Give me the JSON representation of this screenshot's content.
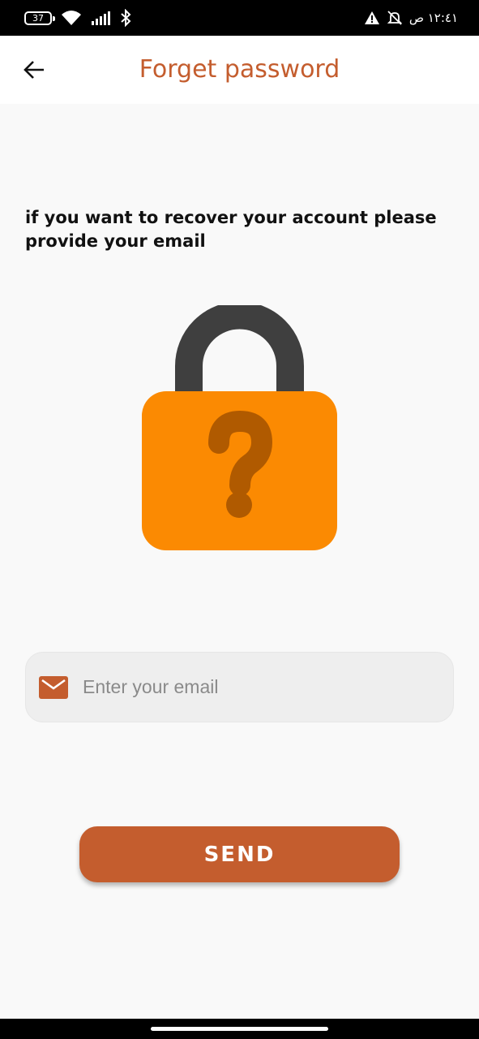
{
  "status_bar": {
    "battery": "37",
    "time": "١٢:٤١ ص"
  },
  "app_bar": {
    "title": "Forget password",
    "title_color": "#c45d2e"
  },
  "instruction_text": "if you want to recover your account please provide your email",
  "illustration": {
    "icon": "lock-question-icon",
    "body_color": "#fb8a02",
    "shackle_color": "#3f3f3f",
    "mark_color": "#b05a00"
  },
  "email_field": {
    "icon": "mail-icon",
    "value": "",
    "placeholder": "Enter your email"
  },
  "send_button": {
    "label": "SEND",
    "color": "#c45d2e"
  }
}
